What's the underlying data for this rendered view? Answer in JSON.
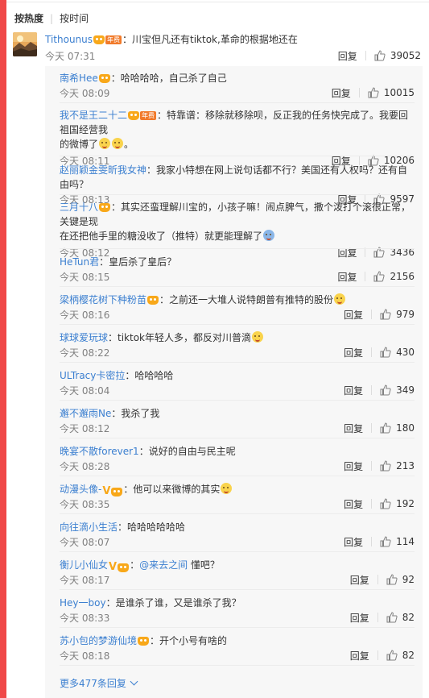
{
  "sort": {
    "hot": "按热度",
    "time": "按时间"
  },
  "top_comment": {
    "user": "Tithounus",
    "text": "：川宝但凡还有tiktok,革命的根据地还在",
    "time": "今天 07:31",
    "reply": "回复",
    "likes": "39052",
    "vip": "年费"
  },
  "replies": [
    {
      "user": "南希Hee",
      "text": "：哈哈哈哈，自己杀了自己",
      "time": "今天 08:09",
      "reply": "回复",
      "likes": "10015",
      "badges": [
        "crown"
      ]
    },
    {
      "user": "我不是王二十二",
      "text_a": "：特靠谱：移除就移除呗，反正我的任务快完成了。我要回祖国经营我",
      "text_b": "的微博了",
      "time": "今天 08:11",
      "reply": "回复",
      "likes": "10206",
      "badges": [
        "crown",
        "vip"
      ],
      "vip": "年费"
    },
    {
      "user": "赵丽颖金雯昕我女神",
      "text": "：我家小特想在网上说句话都不行？美国还有人权吗？还有自由吗？",
      "time": "今天 08:13",
      "reply": "回复",
      "likes": "9597"
    },
    {
      "user": "三月十八",
      "text_a": "：其实还蛮理解川宝的，小孩子嘛！闹点脾气，撒个泼打个滚很正常，关键是现",
      "text_b": "在还把他手里的糖没收了（推特）就更能理解了",
      "time": "今天 08:12",
      "reply": "回复",
      "likes": "3436",
      "badges": [
        "crown"
      ]
    },
    {
      "user": "HeTun君",
      "text": "：皇后杀了皇后？",
      "time": "今天 08:15",
      "reply": "回复",
      "likes": "2156"
    },
    {
      "user": "梁柄樱花树下种粉苗",
      "text": "：之前还一大堆人说特朗普有推特的股份",
      "time": "今天 08:16",
      "reply": "回复",
      "likes": "979",
      "badges": [
        "crown"
      ]
    },
    {
      "user": "球球爱玩球",
      "text": "：tiktok年轻人多，都反对川普滴",
      "time": "今天 08:22",
      "reply": "回复",
      "likes": "430"
    },
    {
      "user": "ULTracy卡密拉",
      "text": "：哈哈哈哈",
      "time": "今天 08:04",
      "reply": "回复",
      "likes": "349"
    },
    {
      "user": "邂不邂雨Ne",
      "text": "：我杀了我",
      "time": "今天 08:12",
      "reply": "回复",
      "likes": "180"
    },
    {
      "user": "晚宴不散forever1",
      "text": "：说好的自由与民主呢",
      "time": "今天 08:28",
      "reply": "回复",
      "likes": "213"
    },
    {
      "user": "动漫头像-",
      "text": "：他可以来微博的其实",
      "time": "今天 08:35",
      "reply": "回复",
      "likes": "192",
      "badges": [
        "v",
        "crown"
      ]
    },
    {
      "user": "向往滴小生活",
      "text": "：哈哈哈哈哈哈",
      "time": "今天 08:07",
      "reply": "回复",
      "likes": "114"
    },
    {
      "user": "衡儿小仙女",
      "text_prefix": "：",
      "mention": "@来去之间",
      "text": " 懂吧？",
      "time": "今天 08:17",
      "reply": "回复",
      "likes": "92",
      "badges": [
        "v",
        "crown"
      ]
    },
    {
      "user": "Hey一boy",
      "text": "：是谁杀了谁，又是谁杀了我？",
      "time": "今天 08:33",
      "reply": "回复",
      "likes": "82"
    },
    {
      "user": "苏小包的梦游仙境",
      "text": "：开个小号有啥的",
      "time": "今天 08:18",
      "reply": "回复",
      "likes": "82",
      "badges": [
        "crown"
      ]
    }
  ],
  "more": "更多477条回复"
}
